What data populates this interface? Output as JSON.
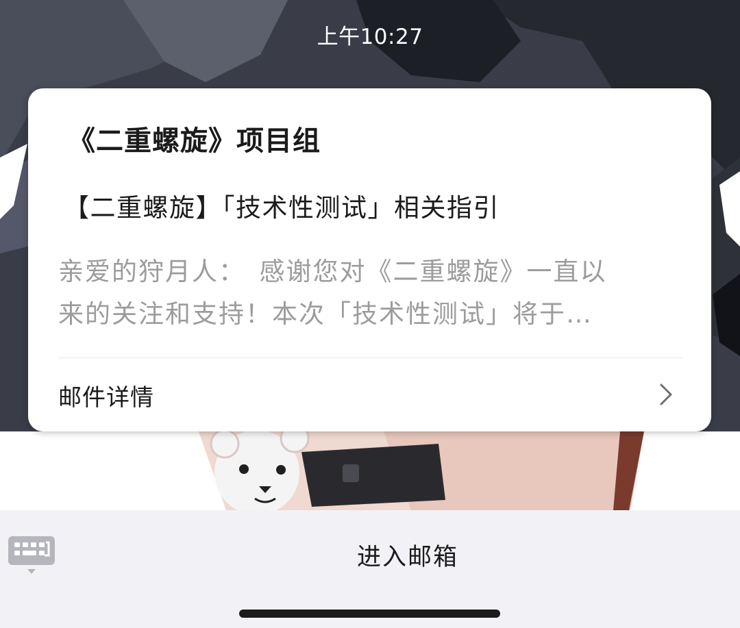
{
  "status_bar": {
    "time": "上午10:27"
  },
  "notification": {
    "sender": "《二重螺旋》项目组",
    "subject": "【二重螺旋】「技术性测试」相关指引",
    "preview_line_1": "亲爱的狩月人：　感谢您对《二重螺旋》一直以",
    "preview_line_2": "来的关注和支持！本次「技术性测试」将于…",
    "details_label": "邮件详情",
    "details_icon": "chevron-right-icon"
  },
  "bottom_bar": {
    "keyboard_icon": "keyboard-toggle-icon",
    "action_label": "进入邮箱"
  },
  "colors": {
    "card_background": "#ffffff",
    "bottom_bar_background": "#f2f2f6",
    "primary_text": "#1b1b1b",
    "secondary_text": "#9c9c9c"
  }
}
